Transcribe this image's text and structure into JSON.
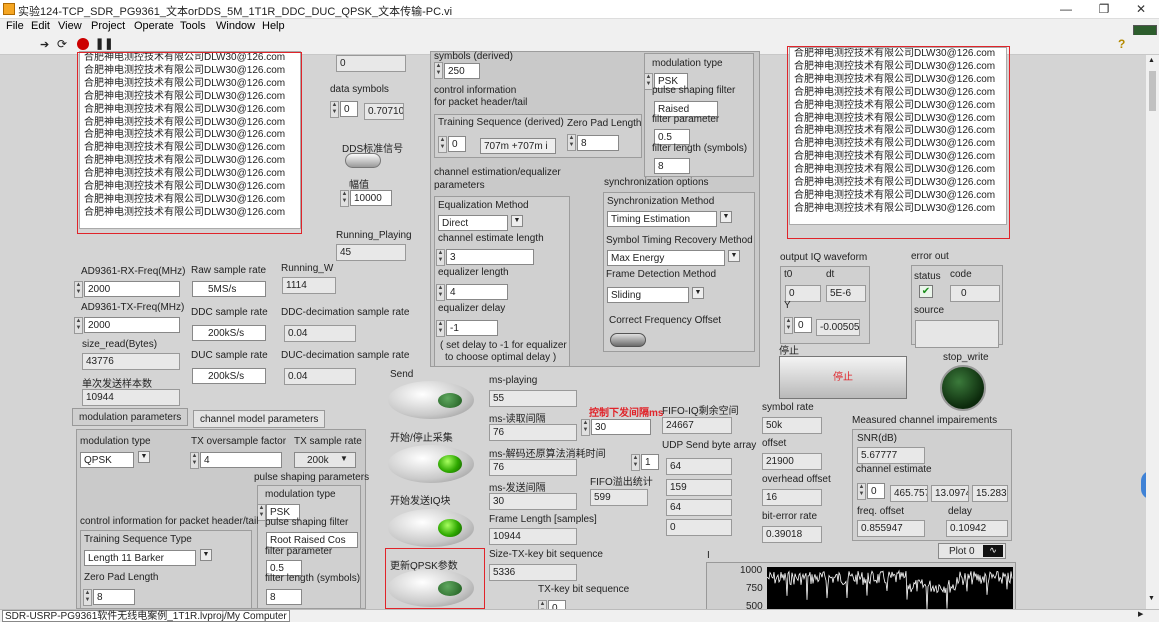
{
  "window": {
    "title": "实验124-TCP_SDR_PG9361_文本orDDS_5M_1T1R_DDC_DUC_QPSK_文本传输-PC.vi",
    "min": "—",
    "max": "❐",
    "close": "✕"
  },
  "menu": [
    "File",
    "Edit",
    "View",
    "Project",
    "Operate",
    "Tools",
    "Window",
    "Help"
  ],
  "text_line": "合肥神电测控技术有限公司DLW30@126.com",
  "text_line_top": "合肥神电测控技术有限公司DLW30@126.com",
  "left_text_lines": 13,
  "right_text_lines": 13,
  "top": {
    "val0": "0",
    "data_symbols_label": "data symbols",
    "ds_idx": "0",
    "ds_val": "0.70710",
    "dds_label": "DDS标准信号",
    "amp_label": "幅值",
    "amp_val": "10000",
    "running_playing_label": "Running_Playing",
    "running_playing_val": "45"
  },
  "mid": {
    "symbols_derived": "symbols (derived)",
    "sym_val": "250",
    "ctrl_info": "control information",
    "ctrl_info2": "for packet header/tail",
    "train_seq_label": "Training Sequence (derived)",
    "train_idx": "0",
    "train_val": "707m +707m i",
    "zero_pad_label": "Zero Pad Length",
    "zero_pad_val": "8",
    "mod_type_label": "modulation type",
    "mod_type_val": "PSK",
    "psf_label": "pulse shaping filter",
    "psf_val": "Raised",
    "filter_param_label": "filter parameter",
    "filter_param_val": "0.5",
    "filter_len_label": "filter length (symbols)",
    "filter_len_val": "8",
    "chan_est_label": "channel estimation/equalizer",
    "params_label": "parameters",
    "eq_method_label": "Equalization Method",
    "eq_method_val": "Direct",
    "chan_est_len_label": "channel estimate length",
    "chan_est_len_val": "3",
    "eq_len_label": "equalizer length",
    "eq_len_val": "4",
    "eq_delay_label": "equalizer delay",
    "eq_delay_val": "-1",
    "eq_note1": "( set delay to -1 for equalizer",
    "eq_note2": "to choose optimal delay )",
    "sync_opts": "synchronization options",
    "sync_method_label": "Synchronization Method",
    "sync_method_val": "Timing Estimation",
    "sym_timing_label": "Symbol Timing Recovery Method",
    "sym_timing_val": "Max Energy",
    "frame_det_label": "Frame Detection Method",
    "frame_det_val": "Sliding",
    "cfo_label": "Correct Frequency Offset"
  },
  "radio": {
    "rx_freq_label": "AD9361-RX-Freq(MHz)",
    "rx_freq_val": "2000",
    "tx_freq_label": "AD9361-TX-Freq(MHz)",
    "tx_freq_val": "2000",
    "raw_sr_label": "Raw sample rate",
    "raw_sr_val": "5MS/s",
    "ddc_sr_label": "DDC sample rate",
    "ddc_sr_val": "200kS/s",
    "duc_sr_label": "DUC sample rate",
    "duc_sr_val": "200kS/s",
    "running_w_label": "Running_W",
    "running_w_val": "1114",
    "ddc_dec_label": "DDC-decimation sample rate",
    "ddc_dec_val": "0.04",
    "duc_dec_label": "DUC-decimation sample rate",
    "duc_dec_val": "0.04",
    "size_read_label": "size_read(Bytes)",
    "size_read_val": "43776",
    "single_label": "单次发送样本数",
    "single_val": "10944"
  },
  "tabs": [
    "modulation parameters",
    "channel model parameters"
  ],
  "modparams": {
    "mod_type_label": "modulation type",
    "mod_type_val": "QPSK",
    "os_label": "TX oversample factor",
    "os_val": "4",
    "tx_sr_label": "TX sample rate",
    "tx_sr_val": "200k",
    "psp_label": "pulse shaping parameters",
    "mod_type2_label": "modulation type",
    "mod_type2_val": "PSK",
    "psf2_label": "pulse shaping filter",
    "psf2_val": "Root Raised Cos",
    "fp2_label": "filter parameter",
    "fp2_val": "0.5",
    "fl2_label": "filter length (symbols)",
    "fl2_val": "8",
    "ctrl_label": "control information for packet header/tail",
    "tsq_label": "Training Sequence Type",
    "tsq_val": "Length 11 Barker",
    "zp_label": "Zero Pad Length",
    "zp_val": "8"
  },
  "buttons": {
    "send": "Send",
    "start_stop": "开始/停止采集",
    "start_iq": "开始发送IQ块",
    "update": "更新QPSK参数"
  },
  "stats": {
    "ms_playing_label": "ms-playing",
    "ms_playing_val": "55",
    "ms_read_label": "ms-读取间隔",
    "ms_read_val": "76",
    "ms_decode_label": "ms-解码还原算法消耗时间",
    "ms_decode_val": "76",
    "ms_send_label": "ms-发送间隔",
    "ms_send_val": "30",
    "ctrl_interval_label": "控制下发间隔ms",
    "ctrl_interval_val": "30",
    "fifo_label": "FIFO-IQ剩余空间",
    "fifo_val": "24667",
    "udp_label": "UDP Send byte array",
    "udp_idx": "1",
    "udp_vals": [
      "64",
      "159",
      "64",
      "0"
    ],
    "fifo_over_label": "FIFO溢出统计",
    "fifo_over_val": "599",
    "frame_len_label": "Frame Length [samples]",
    "frame_len_val": "10944",
    "size_tx_label": "Size-TX-key bit sequence",
    "size_tx_val": "5336",
    "tx_key_label": "TX-key bit sequence",
    "tx_key_idx": "0"
  },
  "output": {
    "iq_label": "output IQ waveform",
    "t0_label": "t0",
    "t0_val": "0",
    "dt_label": "dt",
    "dt_val": "5E-6",
    "y_label": "Y",
    "y_idx": "0",
    "y_val": "-0.00505",
    "stop_label": "停止",
    "stop_btn": "停止",
    "err_label": "error out",
    "status_label": "status",
    "code_label": "code",
    "code_val": "0",
    "source_label": "source",
    "stop_write_label": "stop_write",
    "symrate_label": "symbol rate",
    "symrate_val": "50k",
    "offset_label": "offset",
    "offset_val": "21900",
    "overhead_label": "overhead offset",
    "overhead_val": "16",
    "ber_label": "bit-error rate",
    "ber_val": "0.39018",
    "mci_label": "Measured channel impairements",
    "snr_label": "SNR(dB)",
    "snr_val": "5.67777",
    "chest_label": "channel estimate",
    "chest_idx": "0",
    "chest_vals": [
      "465.757",
      "13.0974",
      "15.283"
    ],
    "freq_off_label": "freq. offset",
    "freq_off_val": "0.855947",
    "delay_label": "delay",
    "delay_val": "0.10942",
    "plot_label": "Plot 0",
    "y_axis": [
      "1000",
      "750",
      "500"
    ]
  },
  "status": {
    "path": "SDR-USRP-PG9361软件无线电案例_1T1R.lvproj/My Computer"
  }
}
